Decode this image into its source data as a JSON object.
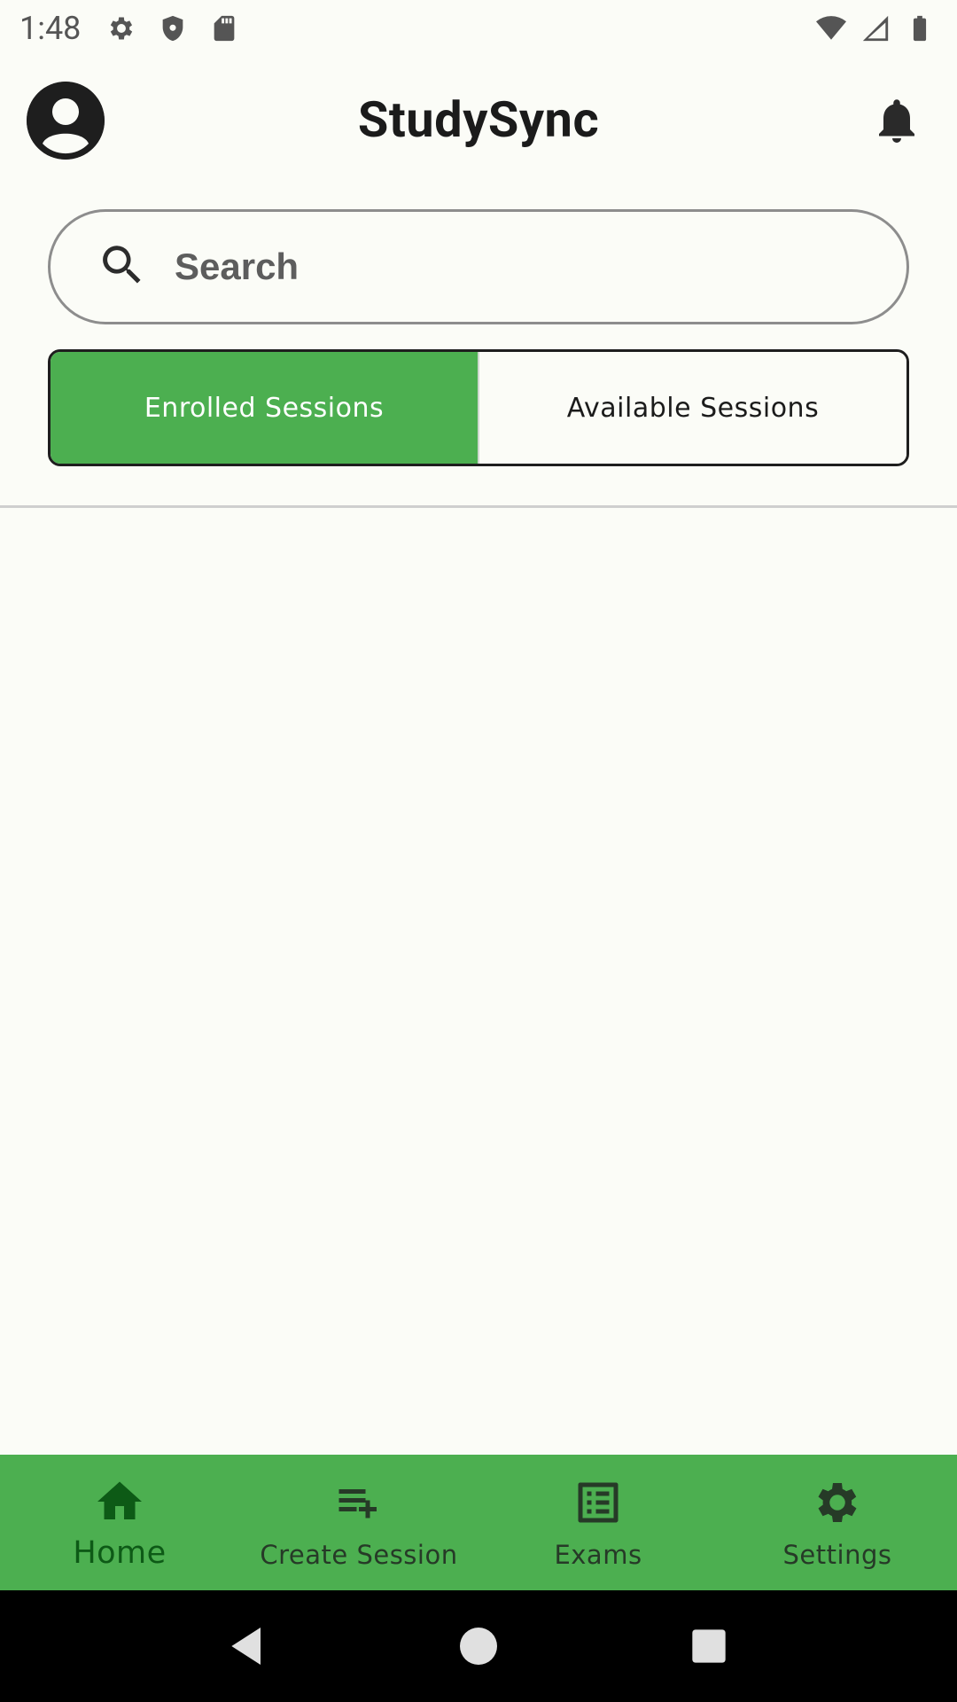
{
  "status_bar": {
    "time": "1:48",
    "left_icons": [
      "gear-icon",
      "shield-icon",
      "sd-card-icon"
    ],
    "right_icons": [
      "wifi-icon",
      "signal-icon",
      "battery-icon"
    ]
  },
  "app_bar": {
    "title": "StudySync",
    "avatar_icon": "account-circle-icon",
    "notification_icon": "bell-icon"
  },
  "search": {
    "placeholder": "Search",
    "value": "",
    "icon": "search-icon"
  },
  "tabs": [
    {
      "label": "Enrolled Sessions",
      "selected": true
    },
    {
      "label": "Available Sessions",
      "selected": false
    }
  ],
  "bottom_nav": {
    "items": [
      {
        "label": "Home",
        "icon": "home-icon",
        "active": true
      },
      {
        "label": "Create Session",
        "icon": "playlist-add-icon",
        "active": false
      },
      {
        "label": "Exams",
        "icon": "list-alt-icon",
        "active": false
      },
      {
        "label": "Settings",
        "icon": "gear-icon",
        "active": false
      }
    ]
  },
  "system_nav": [
    "back-icon",
    "home-circle-icon",
    "recents-icon"
  ],
  "colors": {
    "accent": "#4caf50",
    "background": "#fbfcf7",
    "active_nav": "#0d5a16"
  }
}
